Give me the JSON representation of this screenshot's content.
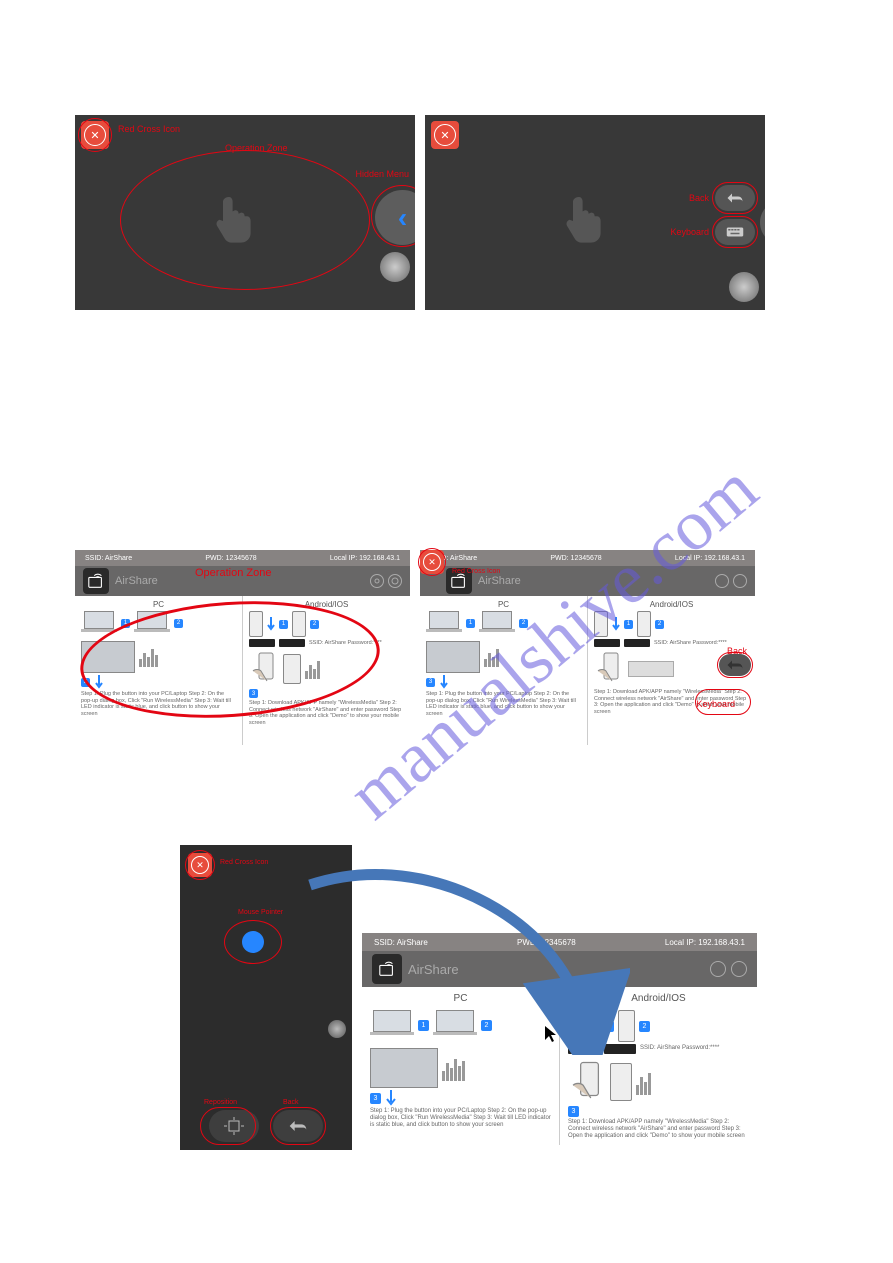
{
  "watermark": "manualshive.com",
  "p1": {
    "close_label": "Red Cross Icon",
    "zone_label": "Operation Zone",
    "hidden_label": "Hidden Menu"
  },
  "p2": {
    "back_label": "Back",
    "keyboard_label": "Keyboard"
  },
  "airshare": {
    "ssid_label": "SSID:",
    "ssid_value": "AirShare",
    "pwd_label": "PWD:",
    "pwd_value": "12345678",
    "ip_label": "Local IP:",
    "ip_value": "192.168.43.1",
    "title": "AirShare",
    "pc_label": "PC",
    "android_label": "Android/IOS",
    "zone_label": "Operation Zone",
    "close_label": "Red Cross Icon",
    "back_label": "Back",
    "keyboard_label": "Keyboard",
    "ssid_caption": "SSID: AirShare Password:****",
    "pc_steps": "Step 1: Plug the button into your PC/Laptop\nStep 2: On the pop-up dialog box, Click \"Run WirelessMedia\"\nStep 3: Wait till LED indicator is static blue, and click button to show your screen",
    "android_steps": "Step 1: Download APK/APP namely \"WirelessMedia\"\nStep 2: Connect wireless network \"AirShare\" and enter password\nStep 3: Open the application and click \"Demo\" to show your mobile screen"
  },
  "p3": {
    "close_label": "Red Cross Icon",
    "pointer_label": "Mouse Pointer",
    "reposition_label": "Reposition",
    "back_label": "Back"
  }
}
